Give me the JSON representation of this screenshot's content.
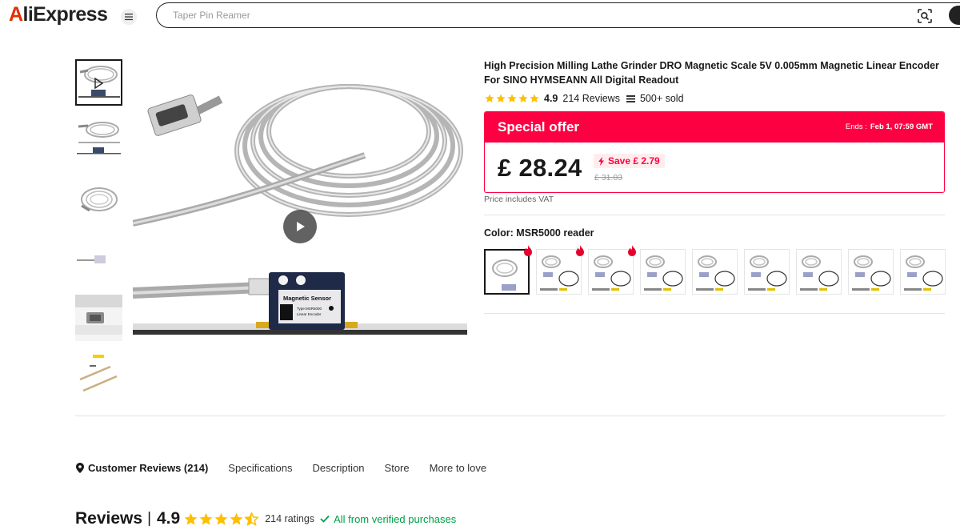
{
  "header": {
    "logo_prefix": "A",
    "logo_rest": "liExpress",
    "search_placeholder": "Taper Pin Reamer"
  },
  "gallery": {
    "thumbnail_count": 6,
    "selected_index": 0
  },
  "product": {
    "title": "High Precision Milling Lathe Grinder DRO Magnetic Scale 5V 0.005mm Magnetic Linear Encoder For SINO HYMSEANN All Digital Readout",
    "rating": "4.9",
    "reviews": "214 Reviews",
    "sold": "500+ sold",
    "image_label_1": "Magnetic Sensor",
    "image_label_2": "Type:MSR5000",
    "image_label_3": "Linear Encoder"
  },
  "offer": {
    "label": "Special offer",
    "ends_label": "Ends :",
    "ends_value": "Feb 1, 07:59 GMT",
    "price": "£ 28.24",
    "save": "Save  £ 2.79",
    "original_price": "£ 31.03",
    "vat_note": "Price includes VAT"
  },
  "color": {
    "label": "Color: MSR5000 reader",
    "swatch_count": 9,
    "selected_index": 0,
    "hot_indices": [
      0,
      1,
      2
    ]
  },
  "tabs": {
    "items": [
      "Customer Reviews (214)",
      "Specifications",
      "Description",
      "Store",
      "More to love"
    ],
    "active": "Customer Reviews (214)"
  },
  "reviews": {
    "title": "Reviews",
    "separator": "|",
    "score": "4.9",
    "count": "214 ratings",
    "verified": "All from verified purchases"
  },
  "colors": {
    "accent_red": "#fd0042",
    "star_yellow": "#fdbf00",
    "verified_green": "#00a046"
  }
}
